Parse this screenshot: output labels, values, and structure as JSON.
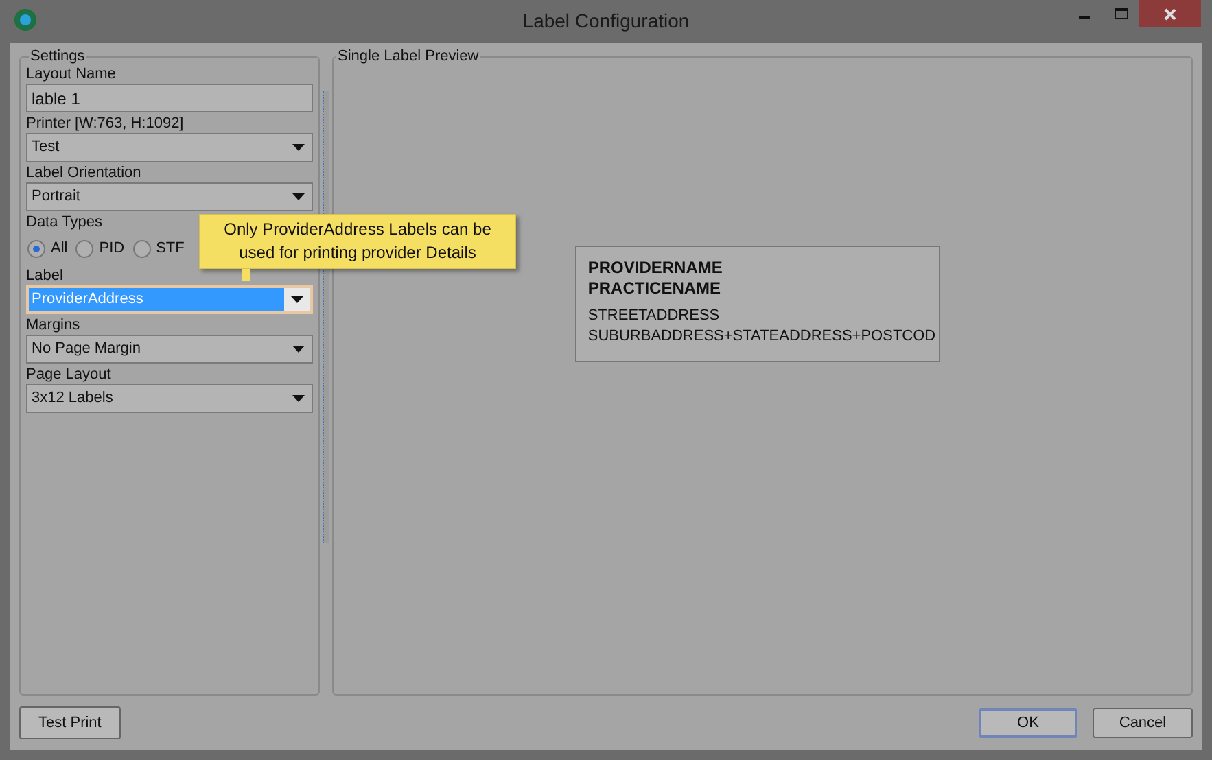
{
  "window": {
    "title": "Label Configuration"
  },
  "settings": {
    "title": "Settings",
    "groups": [
      {
        "label": "Layout Name",
        "kind": "text",
        "value": "lable 1"
      },
      {
        "label": "Printer [W:763, H:1092]",
        "kind": "select",
        "value": "Test",
        "highlighted": false
      },
      {
        "label": "Label Orientation",
        "kind": "select",
        "value": "Portrait",
        "highlighted": false
      },
      {
        "label": "Data Types",
        "kind": "radios",
        "options": [
          {
            "label": "All",
            "selected": true
          },
          {
            "label": "PID",
            "selected": false
          },
          {
            "label": "STF",
            "selected": false
          }
        ]
      },
      {
        "label": "Label",
        "kind": "select",
        "value": "ProviderAddress",
        "highlighted": true
      },
      {
        "label": "Margins",
        "kind": "select",
        "value": "No Page Margin",
        "highlighted": false
      },
      {
        "label": "Page Layout",
        "kind": "select",
        "value": "3x12 Labels",
        "highlighted": false
      }
    ]
  },
  "tooltip": {
    "text": "Only ProviderAddress Labels can be used for printing provider Details"
  },
  "preview": {
    "title": "Single Label Preview",
    "lines": [
      {
        "text": "PROVIDERNAME",
        "bold": true
      },
      {
        "text": "PRACTICENAME",
        "bold": true
      },
      {
        "text": "STREETADDRESS",
        "bold": false
      },
      {
        "text": "SUBURBADDRESS+STATEADDRESS+POSTCOD",
        "bold": false
      }
    ]
  },
  "buttons": {
    "left": "Test Print",
    "ok": "OK",
    "cancel": "Cancel"
  }
}
